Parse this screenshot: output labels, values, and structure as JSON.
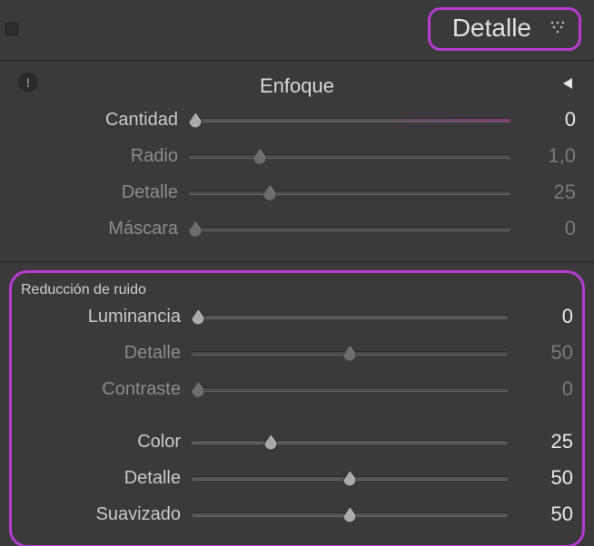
{
  "header": {
    "title": "Detalle"
  },
  "sharpening": {
    "title": "Enfoque",
    "sliders": [
      {
        "label": "Cantidad",
        "value": "0",
        "pos": 2,
        "enabled": true,
        "highlight": true
      },
      {
        "label": "Radio",
        "value": "1,0",
        "pos": 22,
        "enabled": false,
        "highlight": false
      },
      {
        "label": "Detalle",
        "value": "25",
        "pos": 25,
        "enabled": false,
        "highlight": false
      },
      {
        "label": "Máscara",
        "value": "0",
        "pos": 2,
        "enabled": false,
        "highlight": false
      }
    ]
  },
  "noise": {
    "title": "Reducción de ruido",
    "luminance": [
      {
        "label": "Luminancia",
        "value": "0",
        "pos": 2,
        "enabled": true
      },
      {
        "label": "Detalle",
        "value": "50",
        "pos": 50,
        "enabled": false
      },
      {
        "label": "Contraste",
        "value": "0",
        "pos": 2,
        "enabled": false
      }
    ],
    "color": [
      {
        "label": "Color",
        "value": "25",
        "pos": 25,
        "enabled": true
      },
      {
        "label": "Detalle",
        "value": "50",
        "pos": 50,
        "enabled": true
      },
      {
        "label": "Suavizado",
        "value": "50",
        "pos": 50,
        "enabled": true
      }
    ]
  }
}
